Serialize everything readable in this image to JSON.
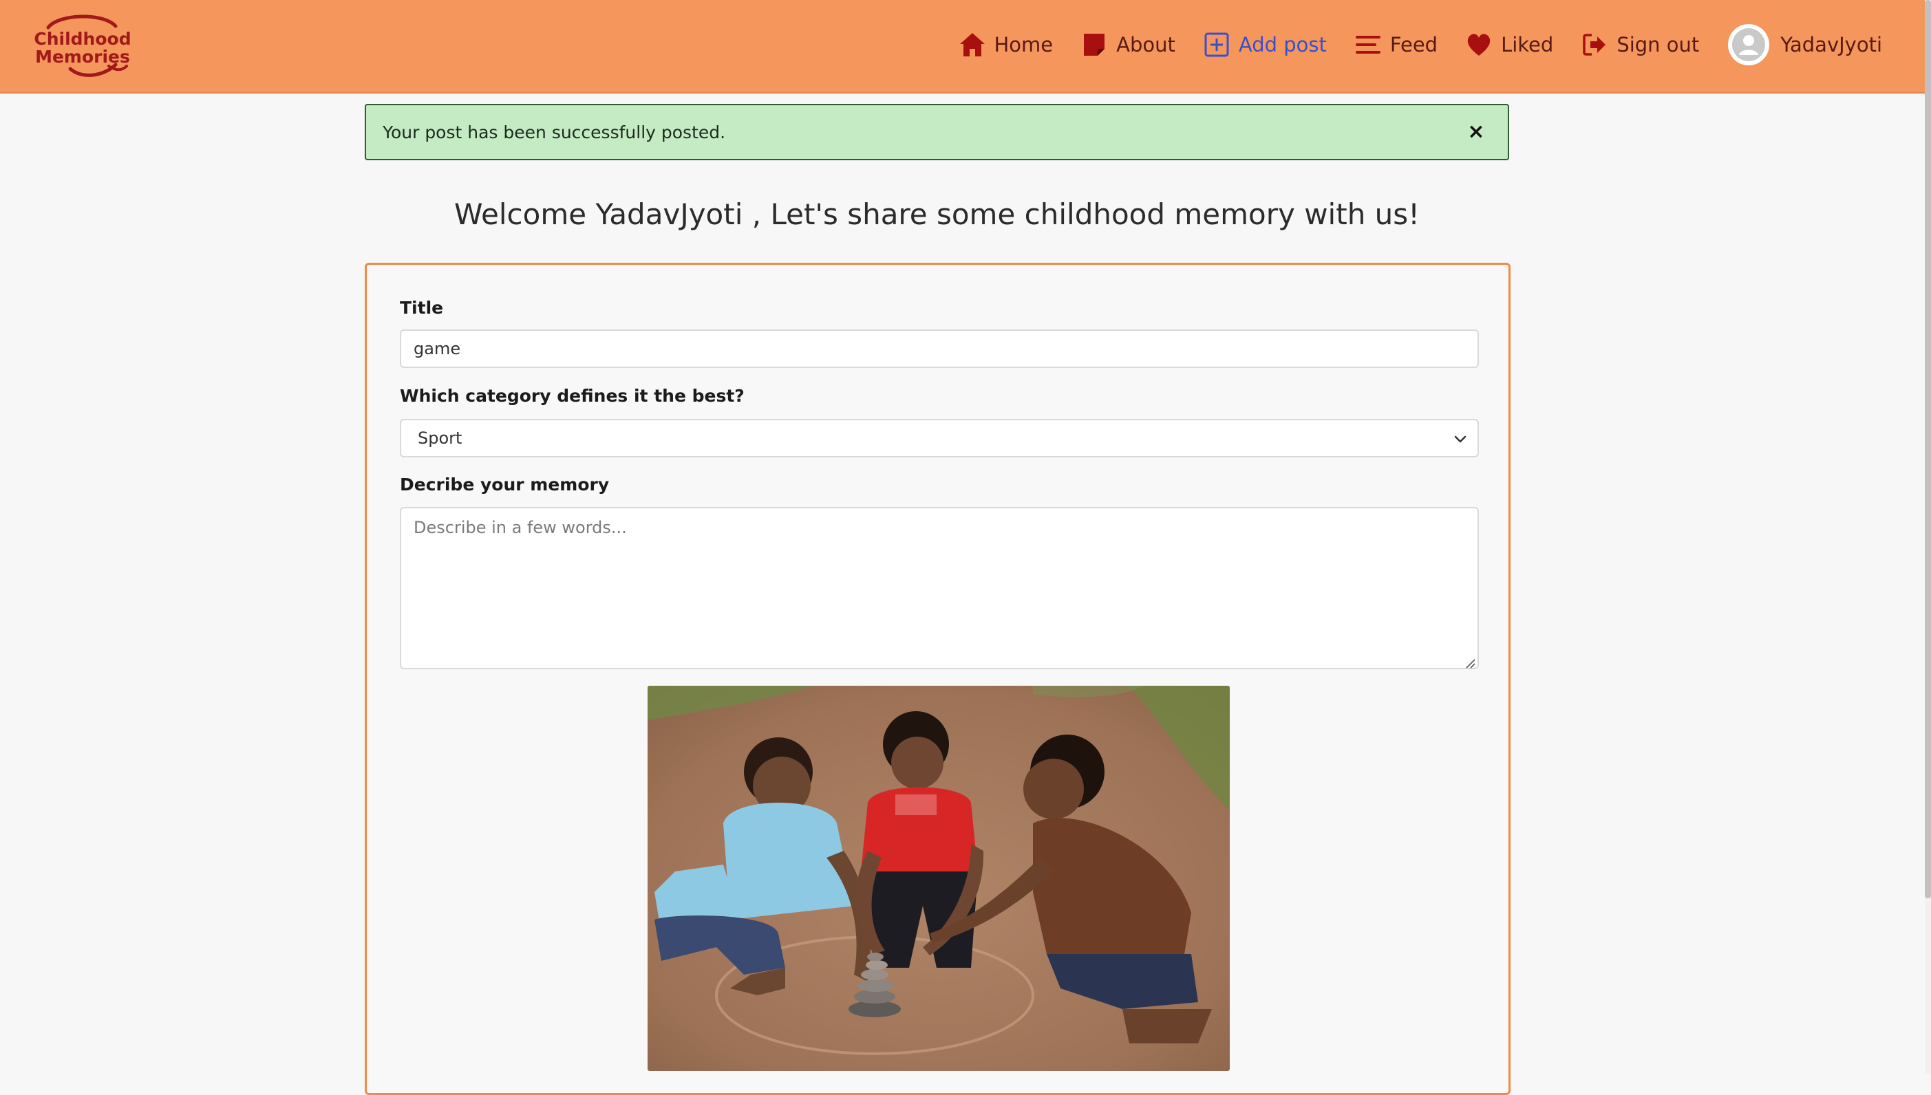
{
  "brand": {
    "logo_line1": "Childhood",
    "logo_line2": "Memories",
    "color": "#a11919"
  },
  "nav": {
    "items": [
      {
        "label": "Home",
        "icon": "home-icon"
      },
      {
        "label": "About",
        "icon": "note-icon"
      },
      {
        "label": "Add post",
        "icon": "plus-square-icon",
        "active": true
      },
      {
        "label": "Feed",
        "icon": "menu-lines-icon"
      },
      {
        "label": "Liked",
        "icon": "heart-icon"
      },
      {
        "label": "Sign out",
        "icon": "sign-out-icon"
      }
    ],
    "user_name": "YadavJyoti",
    "background": "#f5975d",
    "active_color": "#3b4fc7"
  },
  "alert": {
    "message": "Your post has been successfully posted.",
    "close_glyph": "×",
    "background": "#c4ebc4"
  },
  "welcome": "Welcome YadavJyoti , Let's share some childhood memory with us!",
  "form": {
    "title_label": "Title",
    "title_value": "game",
    "category_label": "Which category defines it the best?",
    "category_value": "Sport",
    "description_label": "Decribe your memory",
    "description_placeholder": "Describe in a few words...",
    "description_value": "",
    "image_subject": "photo of three boys playing a stone-stacking game in the dirt",
    "border_color": "#f08a45"
  }
}
